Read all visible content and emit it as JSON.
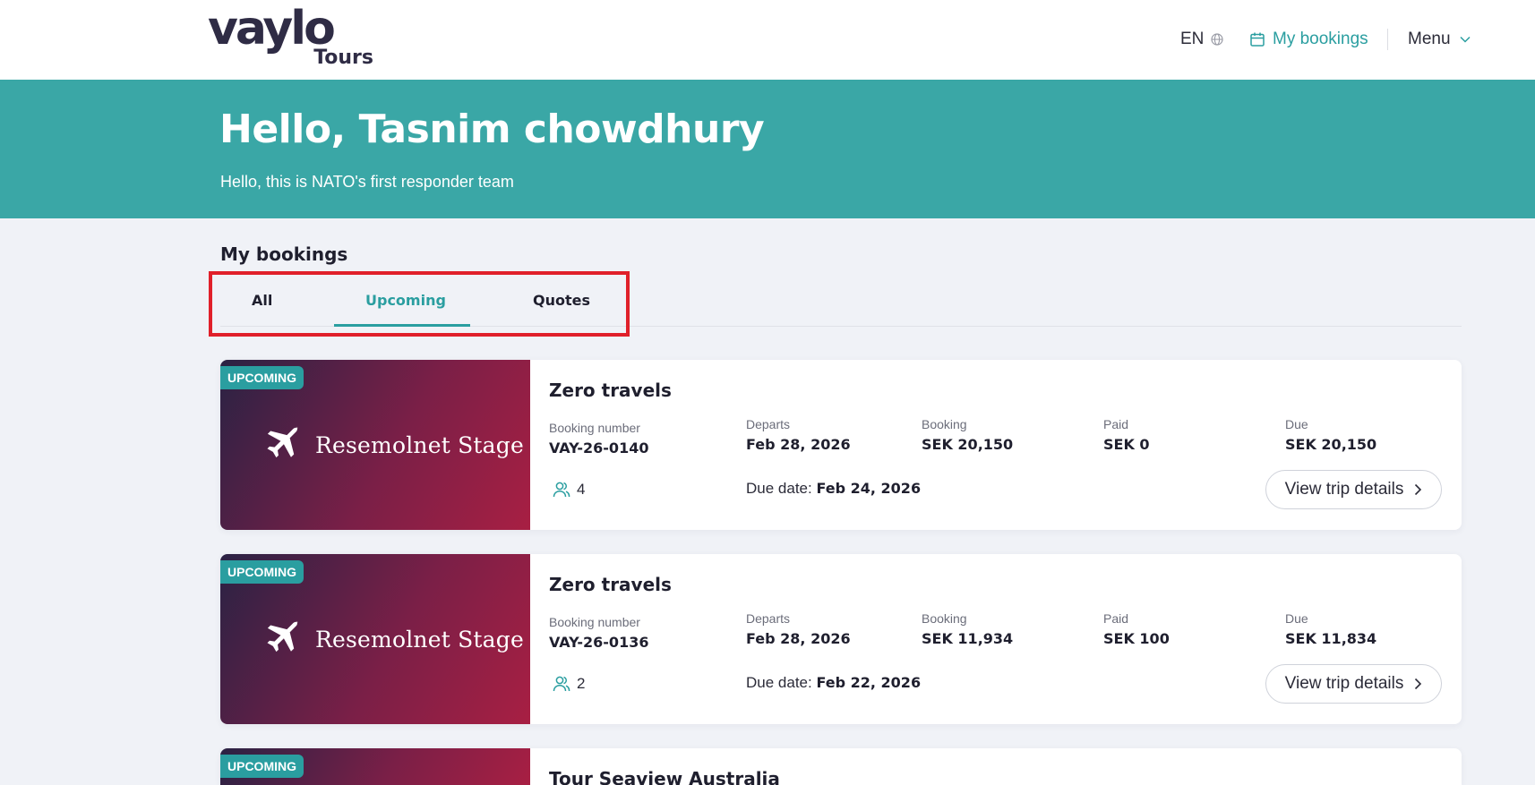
{
  "header": {
    "logo_main": "vaylo",
    "logo_sub": "Tours",
    "lang_label": "EN",
    "my_bookings_label": "My bookings",
    "menu_label": "Menu"
  },
  "hero": {
    "title": "Hello, Tasnim chowdhury",
    "subtitle": "Hello, this is NATO's first responder team"
  },
  "section": {
    "title": "My bookings",
    "tabs": [
      {
        "label": "All"
      },
      {
        "label": "Upcoming",
        "active": true
      },
      {
        "label": "Quotes"
      }
    ]
  },
  "labels": {
    "booking_number": "Booking number",
    "departs": "Departs",
    "booking": "Booking",
    "paid": "Paid",
    "due": "Due",
    "due_date": "Due date:",
    "view_details": "View trip details"
  },
  "bookings": [
    {
      "badge": "UPCOMING",
      "brand": "Resemolnet Stage",
      "title": "Zero travels",
      "booking_number": "VAY-26-0140",
      "departs": "Feb 28, 2026",
      "booking_amount": "SEK 20,150",
      "paid": "SEK 0",
      "due": "SEK 20,150",
      "travellers": "4",
      "due_date": "Feb 24, 2026"
    },
    {
      "badge": "UPCOMING",
      "brand": "Resemolnet Stage",
      "title": "Zero travels",
      "booking_number": "VAY-26-0136",
      "departs": "Feb 28, 2026",
      "booking_amount": "SEK 11,934",
      "paid": "SEK 100",
      "due": "SEK 11,834",
      "travellers": "2",
      "due_date": "Feb 22, 2026"
    },
    {
      "badge": "UPCOMING",
      "title": "Tour Seaview Australia"
    }
  ],
  "colors": {
    "accent": "#2a9ea0",
    "hero_bg": "#3aa7a6",
    "highlight_box": "#e0202a"
  }
}
